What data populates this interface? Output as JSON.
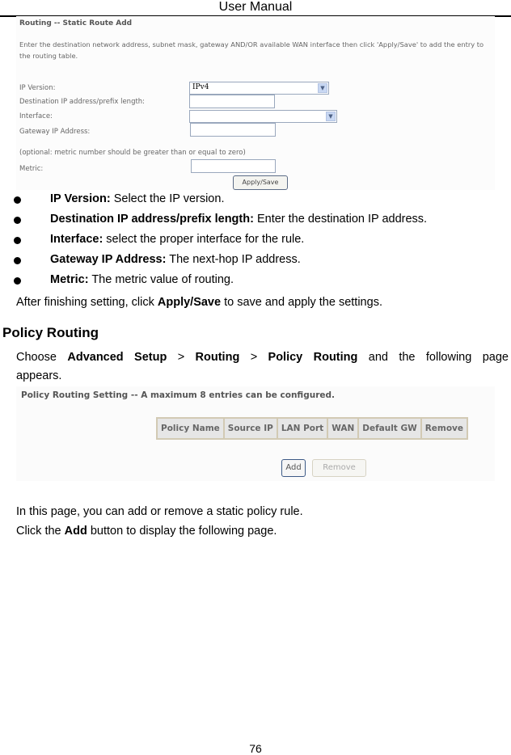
{
  "header": {
    "title": "User Manual"
  },
  "static_route_screenshot": {
    "title": "Routing -- Static Route Add",
    "description": "Enter the destination network address, subnet mask, gateway AND/OR available WAN interface then click 'Apply/Save' to add the entry to the routing table.",
    "fields": {
      "ip_version_label": "IP Version:",
      "ip_version_value": "IPv4",
      "destination_label": "Destination IP address/prefix length:",
      "destination_value": "",
      "interface_label": "Interface:",
      "interface_value": "",
      "gateway_label": "Gateway IP Address:",
      "gateway_value": "",
      "metric_note": "(optional: metric number should be greater than or equal to zero)",
      "metric_label": "Metric:",
      "metric_value": ""
    },
    "apply_button": "Apply/Save"
  },
  "bullets": [
    {
      "term": "IP Version:",
      "text": " Select the IP version."
    },
    {
      "term": "Destination IP address/prefix length:",
      "text": " Enter the destination IP address."
    },
    {
      "term": "Interface:",
      "text": " select the proper interface for the rule."
    },
    {
      "term": "Gateway IP Address:",
      "text": " The next-hop IP address."
    },
    {
      "term": "Metric:",
      "text": " The metric value of routing."
    }
  ],
  "after_finishing": {
    "prefix": "After finishing setting, click ",
    "bold": "Apply/Save",
    "suffix": " to save and apply the settings."
  },
  "policy_routing": {
    "heading": "Policy Routing",
    "intro": {
      "w1": "Choose",
      "b1": "Advanced",
      "b2": "Setup",
      "sep1": ">",
      "b3": "Routing",
      "sep2": ">",
      "b4": "Policy",
      "b5": "Routing",
      "w2": "and",
      "w3": "the",
      "w4": "following",
      "w5": "page",
      "line2": "appears."
    },
    "screenshot": {
      "title": "Policy Routing Setting -- A maximum 8 entries can be configured.",
      "columns": [
        "Policy Name",
        "Source IP",
        "LAN Port",
        "WAN",
        "Default GW",
        "Remove"
      ],
      "add_button": "Add",
      "remove_button": "Remove"
    },
    "para1": "In this page, you can add or remove a static policy rule.",
    "para2": {
      "prefix": "Click the ",
      "bold": "Add",
      "suffix": " button to display the following page."
    }
  },
  "footer": {
    "page_number": "76"
  }
}
